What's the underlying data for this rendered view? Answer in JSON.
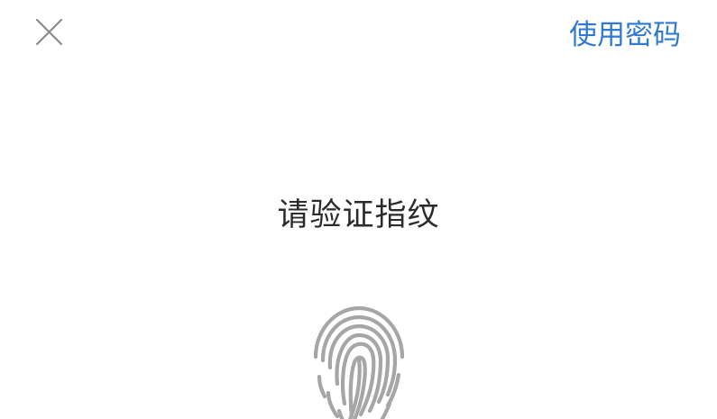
{
  "header": {
    "close_icon": "close-icon",
    "use_password_label": "使用密码"
  },
  "main": {
    "prompt": "请验证指纹",
    "fingerprint_icon": "fingerprint-icon"
  },
  "colors": {
    "background": "#ffffff",
    "accent": "#2f7ad0",
    "text": "#2b2b2b",
    "icon": "#a6a6a6",
    "close_icon": "#8c8c8c"
  }
}
